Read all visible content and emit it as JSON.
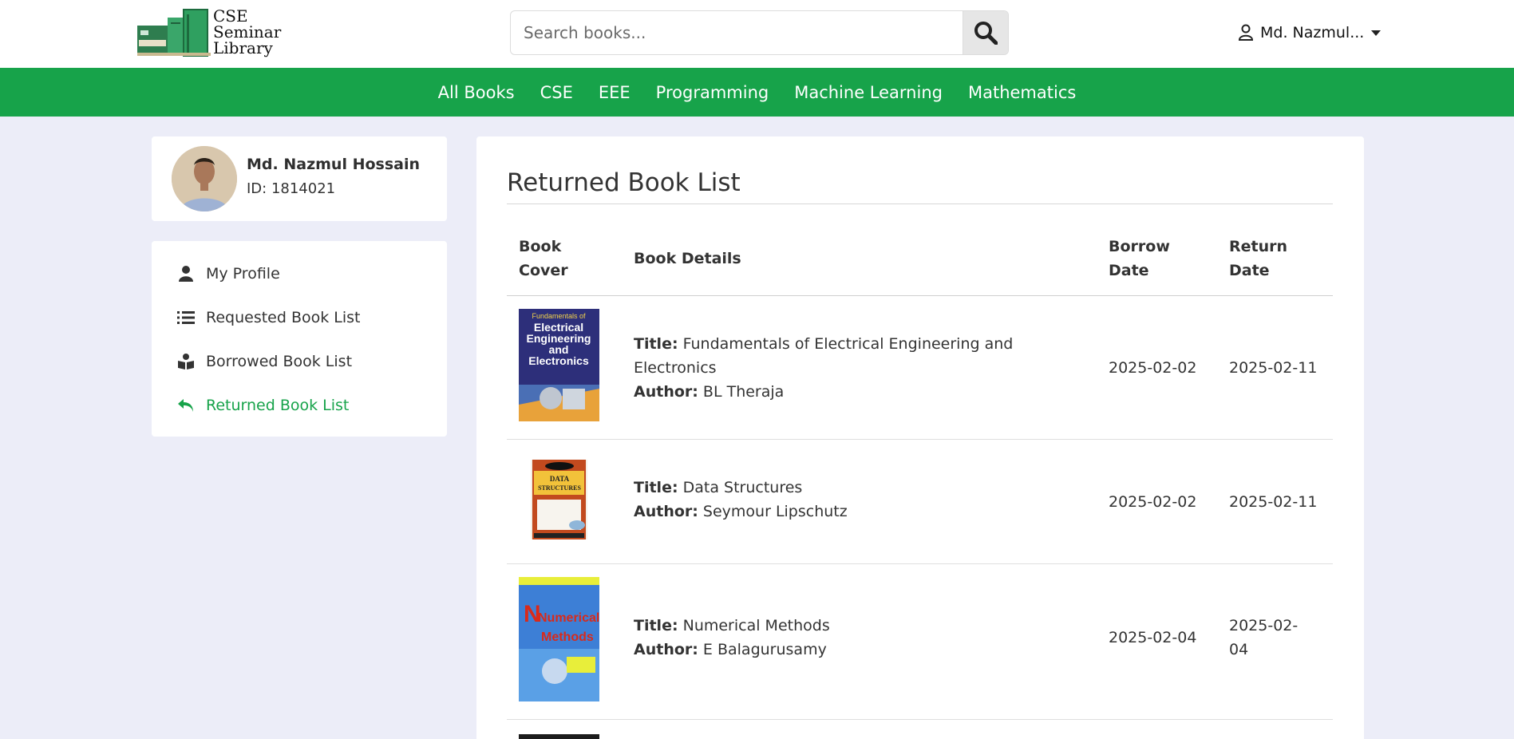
{
  "header": {
    "logo_line1": "CSE",
    "logo_line2": "Seminar",
    "logo_line3": "Library",
    "search_placeholder": "Search books...",
    "user_name": "Md. Nazmul..."
  },
  "nav": {
    "items": [
      "All Books",
      "CSE",
      "EEE",
      "Programming",
      "Machine Learning",
      "Mathematics"
    ]
  },
  "profile": {
    "name": "Md. Nazmul Hossain",
    "id": "ID: 1814021"
  },
  "sidebar": {
    "items": [
      {
        "label": "My Profile",
        "icon": "user-icon"
      },
      {
        "label": "Requested Book List",
        "icon": "list-icon"
      },
      {
        "label": "Borrowed Book List",
        "icon": "book-reader-icon"
      },
      {
        "label": "Returned Book List",
        "icon": "reply-icon"
      }
    ],
    "active_color": "#17a34a"
  },
  "main": {
    "title": "Returned Book List",
    "columns": {
      "cover_1": "Book",
      "cover_2": "Cover",
      "details": "Book Details",
      "borrow_1": "Borrow",
      "borrow_2": "Date",
      "return_1": "Return",
      "return_2": "Date"
    },
    "title_label": "Title:",
    "author_label": "Author:",
    "rows": [
      {
        "title": "Fundamentals of Electrical Engineering and Electronics",
        "author": "BL Theraja",
        "borrow_date": "2025-02-02",
        "return_date": "2025-02-11",
        "cover_text": [
          "Fundamentals of",
          "Electrical",
          "Engineering",
          "and",
          "Electronics"
        ]
      },
      {
        "title": "Data Structures",
        "author": "Seymour Lipschutz",
        "borrow_date": "2025-02-02",
        "return_date": "2025-02-11",
        "cover_text": [
          "DATA",
          "STRUCTURES"
        ]
      },
      {
        "title": "Numerical Methods",
        "author": "E Balagurusamy",
        "borrow_date": "2025-02-04",
        "return_date_1": "2025-02-",
        "return_date_2": "04",
        "cover_text": [
          "Numerical",
          "Methods"
        ]
      }
    ]
  },
  "colors": {
    "brand_green": "#17a34a",
    "page_bg": "#ecedf8"
  }
}
